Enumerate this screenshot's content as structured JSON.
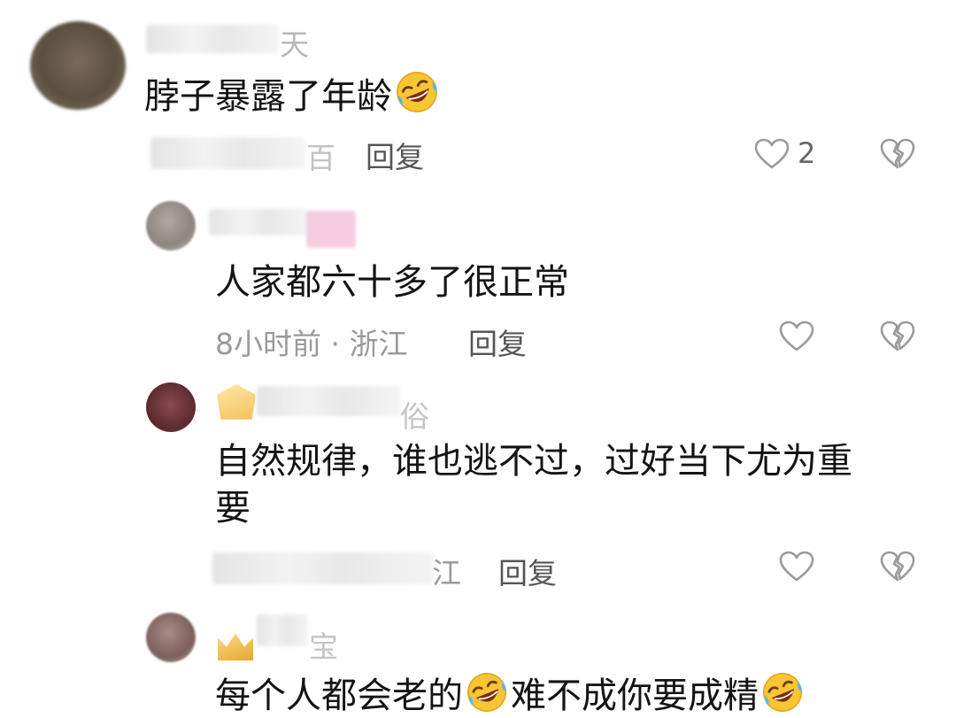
{
  "comments": [
    {
      "username_fragment": "天",
      "text": "脖子暴露了年龄",
      "emoji": "rofl",
      "meta_fragment": "百",
      "reply_label": "回复",
      "likes": "2"
    },
    {
      "text": "人家都六十多了很正常",
      "meta": "8小时前 · 浙江",
      "reply_label": "回复"
    },
    {
      "username_fragment": "俗",
      "text_line1": "自然规律，谁也逃不过，过好当下尤为重",
      "text_line2": "要",
      "meta_fragment": "江",
      "reply_label": "回复"
    },
    {
      "username_fragment": "宝",
      "text_part1": "每个人都会老的",
      "text_part2": "难不成你要成精",
      "reply_label": ""
    }
  ],
  "colors": {
    "background": "#ffffff",
    "text": "#141414",
    "meta": "#9a9a9a",
    "icon": "#9b9b9b"
  },
  "icons": [
    "heart-icon",
    "broken-heart-icon",
    "rofl-emoji",
    "crown-badge-icon"
  ]
}
